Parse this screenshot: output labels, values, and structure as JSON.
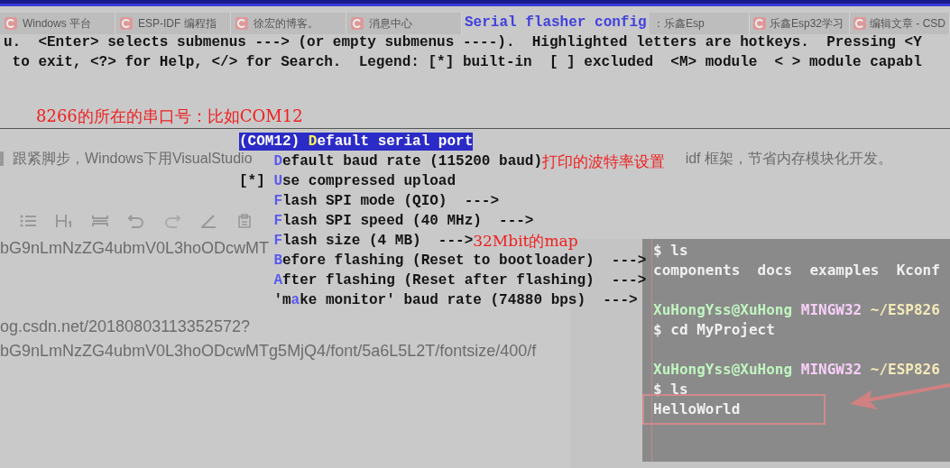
{
  "browser": {
    "tabs": [
      {
        "label": "Windows 平台"
      },
      {
        "label": "ESP-IDF 编程指"
      },
      {
        "label": "徐宏的博客。"
      },
      {
        "label": "消息中心"
      },
      {
        "label": "：乐鑫Esp"
      },
      {
        "label": "乐鑫Esp32学习"
      },
      {
        "label": "编辑文章 - CSD"
      }
    ],
    "article_lead": "跟紧脚步，Windows下用VisualStudio",
    "article_tail": "idf 框架，节省内存模块化开发。",
    "urls": [
      "bG9nLmNzZG4ubmV0L3hoODcwMT",
      "og.csdn.net/20180803113352572?",
      "bG9nLmNzZG4ubmV0L3hoODcwMTg5MjQ4/font/5a6L5L2T/fontsize/400/f"
    ],
    "embedded_terminal": {
      "blocks": [
        [
          [
            {
              "kind": "plain",
              "text": "$ ls"
            }
          ],
          [
            {
              "kind": "plain",
              "text": "components  docs  examples  Kconf"
            }
          ]
        ],
        [
          [
            {
              "kind": "user",
              "text": "XuHongYss@XuHong"
            },
            {
              "kind": "host",
              "text": " MINGW32"
            },
            {
              "kind": "path",
              "text": " ~/ESP826"
            }
          ],
          [
            {
              "kind": "plain",
              "text": "$ cd MyProject"
            }
          ]
        ],
        [
          [
            {
              "kind": "user",
              "text": "XuHongYss@XuHong"
            },
            {
              "kind": "host",
              "text": " MINGW32"
            },
            {
              "kind": "path",
              "text": " ~/ESP826"
            }
          ],
          [
            {
              "kind": "plain",
              "text": "$ ls"
            }
          ],
          [
            {
              "kind": "plain",
              "text": "HelloWorld"
            }
          ]
        ]
      ]
    }
  },
  "menuconfig": {
    "title": "Serial flasher config",
    "help_lines": [
      "u.  <Enter> selects submenus ---> (or empty submenus ----).  Highlighted letters are hotkeys.  Pressing <Y",
      " to exit, <?> for Help, </> for Search.  Legend: [*] built-in  [ ] excluded  <M> module  < > module capabl"
    ],
    "note": "8266的所在的串口号：比如COM12",
    "items": [
      {
        "kind": "string",
        "pre": "(COM12) ",
        "hotkey": "D",
        "post": "efault serial port",
        "selected": true
      },
      {
        "kind": "choice",
        "hotkey": "D",
        "post": "efault baud rate (115200 baud)",
        "note": "打印的波特率设置",
        "selected": false
      },
      {
        "kind": "bool",
        "box": "[*]",
        "hotkey": "U",
        "post": "se compressed upload",
        "selected": false
      },
      {
        "kind": "choice",
        "hotkey": "F",
        "post": "lash SPI mode (QIO)  --->",
        "selected": false
      },
      {
        "kind": "choice",
        "hotkey": "F",
        "post": "lash SPI speed (40 MHz)  --->",
        "selected": false
      },
      {
        "kind": "choice",
        "hotkey": "F",
        "post": "lash size (4 MB)  --->",
        "note": "32Mbit的map",
        "selected": false
      },
      {
        "kind": "choice",
        "hotkey": "B",
        "post": "efore flashing (Reset to bootloader)  --->",
        "selected": false
      },
      {
        "kind": "choice",
        "hotkey": "A",
        "post": "fter flashing (Reset after flashing)  --->",
        "selected": false
      },
      {
        "kind": "choice",
        "pre": "'m",
        "hotkey": "a",
        "post": "ke monitor' baud rate (74880 bps)  --->",
        "selected": false
      }
    ]
  }
}
